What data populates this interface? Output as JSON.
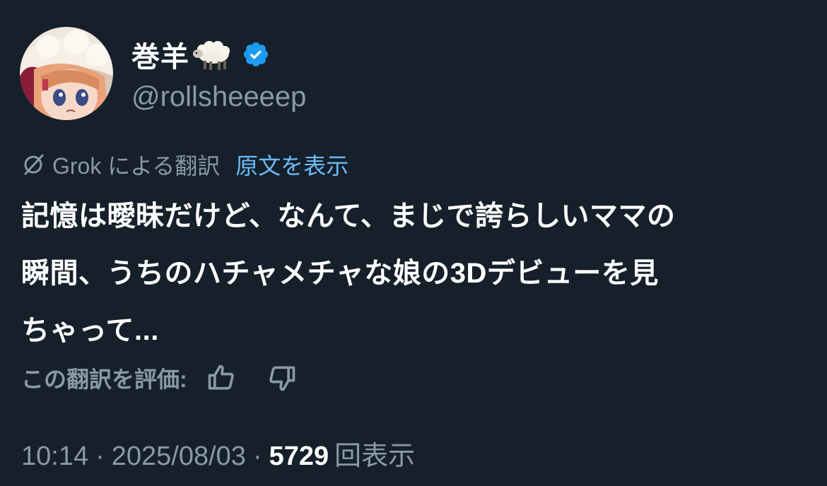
{
  "user": {
    "display_name": "巻羊",
    "name_emoji": "sheep-emoji",
    "handle": "@rollsheeeep",
    "verified": true
  },
  "translation": {
    "label": "Grok による翻訳",
    "show_original": "原文を表示"
  },
  "tweet": {
    "text": "記憶は曖昧だけど、なんて、まじで誇らしいママの\n瞬間、うちのハチャメチャな娘の3Dデビューを見\nちゃって..."
  },
  "rating": {
    "label": "この翻訳を評価:"
  },
  "meta": {
    "time": "10:14",
    "separator": "·",
    "date": "2025/08/03",
    "views_count": "5729",
    "views_label": "回表示"
  },
  "colors": {
    "background": "#15202b",
    "link": "#6cbcf7",
    "verified": "#1d9bf0",
    "muted": "#8b98a5"
  }
}
